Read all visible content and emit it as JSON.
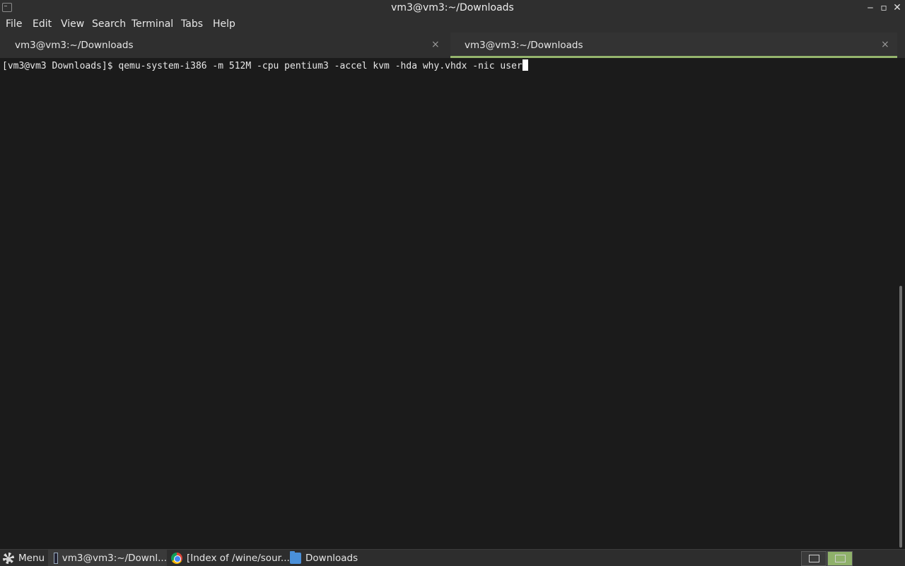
{
  "window": {
    "title": "vm3@vm3:~/Downloads",
    "minimize": "‒",
    "maximize": "▫",
    "close": "✕"
  },
  "menubar": {
    "items": [
      "File",
      "Edit",
      "View",
      "Search",
      "Terminal",
      "Tabs",
      "Help"
    ]
  },
  "tabs": [
    {
      "label": "vm3@vm3:~/Downloads",
      "close": "×",
      "active": false
    },
    {
      "label": "vm3@vm3:~/Downloads",
      "close": "×",
      "active": true
    }
  ],
  "terminal": {
    "prompt": "[vm3@vm3 Downloads]$ ",
    "command": "qemu-system-i386 -m 512M -cpu pentium3 -accel kvm -hda why.vhdx -nic user"
  },
  "taskbar": {
    "menu_label": "Menu",
    "tasks": [
      {
        "label": "vm3@vm3:~/Downl...",
        "icon": "terminal-icon"
      },
      {
        "label": "[Index of /wine/sour...",
        "icon": "chrome-icon"
      },
      {
        "label": "Downloads",
        "icon": "folder-icon"
      }
    ]
  },
  "colors": {
    "accent": "#95b56d",
    "background": "#1b1b1b"
  }
}
